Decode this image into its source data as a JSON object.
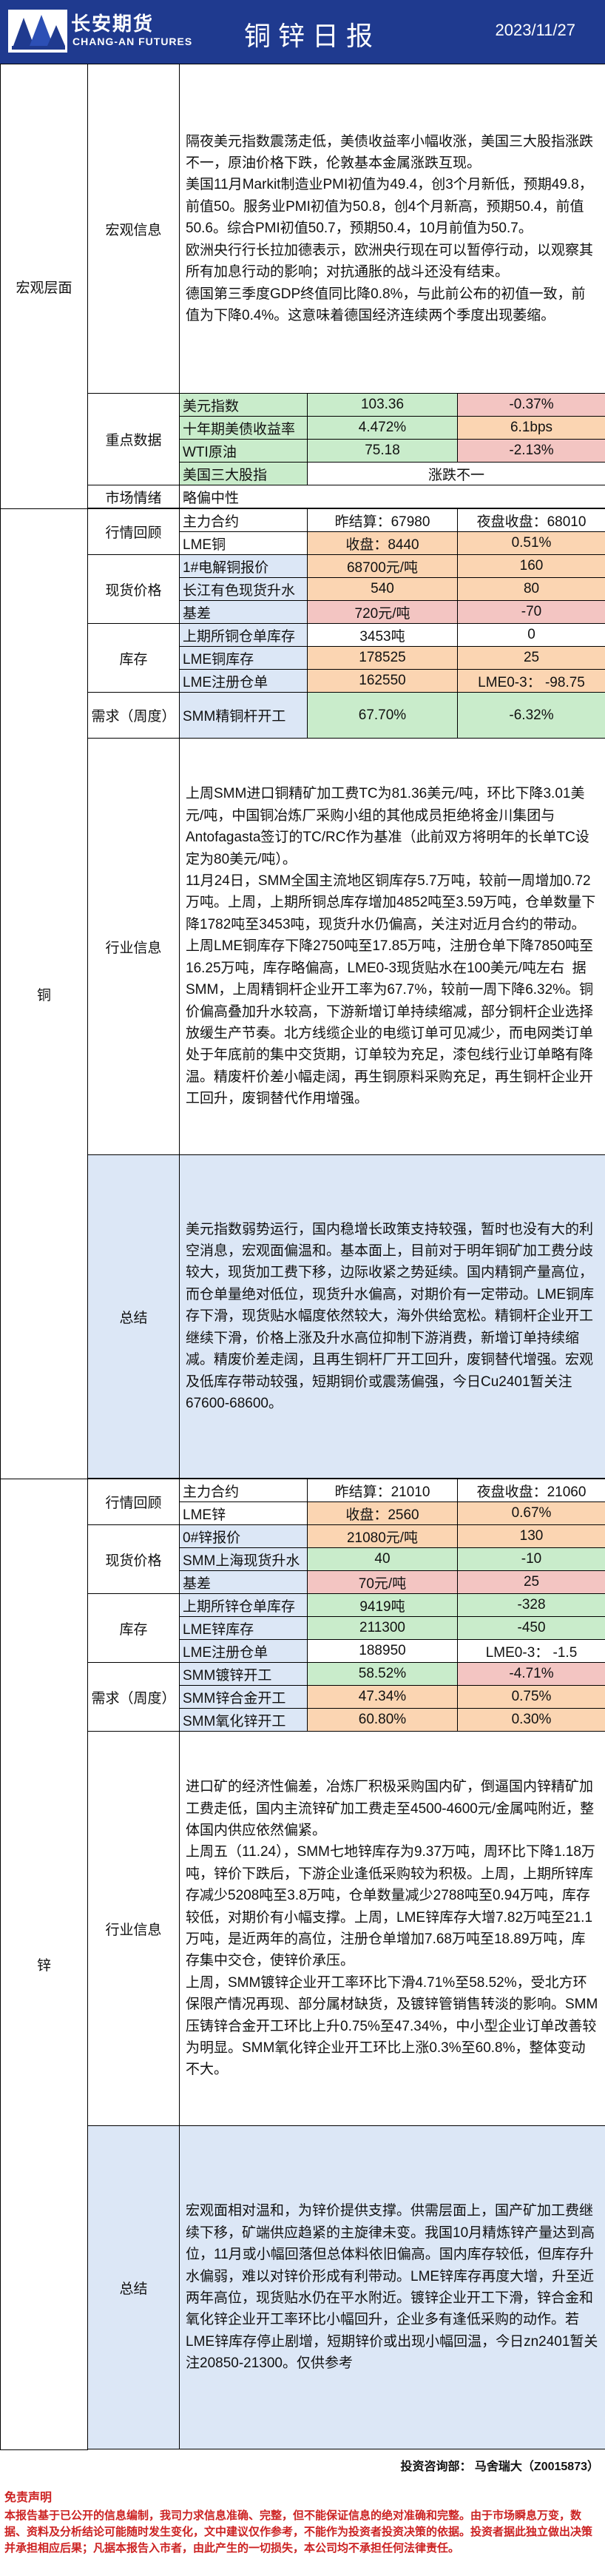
{
  "header": {
    "logo_cn": "长安期货",
    "logo_en": "CHANG-AN FUTURES",
    "title": "铜锌日报",
    "date": "2023/11/27"
  },
  "macro": {
    "section": "宏观层面",
    "info_label": "宏观信息",
    "info_text": "隔夜美元指数震荡走低，美债收益率小幅收涨，美国三大股指涨跌不一，原油价格下跌，伦敦基本金属涨跌互现。\n美国11月Markit制造业PMI初值为49.4，创3个月新低，预期49.8，前值50。服务业PMI初值为50.8，创4个月新高，预期50.4，前值50.6。综合PMI初值50.7，预期50.4，10月前值为50.7。\n欧洲央行行长拉加德表示，欧洲央行现在可以暂停行动，以观察其所有加息行动的影响；对抗通胀的战斗还没有结束。\n德国第三季度GDP终值同比降0.8%，与此前公布的初值一致，前值为下降0.4%。这意味着德国经济连续两个季度出现萎缩。",
    "key_label": "重点数据",
    "key_rows": [
      {
        "name": "美元指数",
        "value": "103.36",
        "change": "-0.37%"
      },
      {
        "name": "十年期美债收益率",
        "value": "4.472%",
        "change": "6.1bps"
      },
      {
        "name": "WTI原油",
        "value": "75.18",
        "change": "-2.13%"
      },
      {
        "name": "美国三大股指",
        "value": "",
        "change": "涨跌不一"
      }
    ],
    "sentiment_label": "市场情绪",
    "sentiment_value": "略偏中性"
  },
  "copper": {
    "section": "铜",
    "review_label": "行情回顾",
    "review_rows": [
      {
        "name": "主力合约",
        "a": "昨结算：67980",
        "b": "夜盘收盘：68010"
      },
      {
        "name": "LME铜",
        "a": "收盘：8440",
        "b": "0.51%"
      }
    ],
    "spot_label": "现货价格",
    "spot_rows": [
      {
        "name": "1#电解铜报价",
        "a": "68700元/吨",
        "b": "160"
      },
      {
        "name": "长江有色现货升水",
        "a": "540",
        "b": "80"
      },
      {
        "name": "基差",
        "a": "720元/吨",
        "b": "-70"
      }
    ],
    "stock_label": "库存",
    "stock_rows": [
      {
        "name": "上期所铜仓单库存",
        "a": "3453吨",
        "b": "0"
      },
      {
        "name": "LME铜库存",
        "a": "178525",
        "b": "25"
      },
      {
        "name": "LME注册仓单",
        "a": "162550",
        "b": "LME0-3：  -98.75"
      }
    ],
    "demand_label": "需求（周度）",
    "demand_rows": [
      {
        "name": "SMM精铜杆开工",
        "a": "67.70%",
        "b": "-6.32%"
      }
    ],
    "industry_label": "行业信息",
    "industry_text": "上周SMM进口铜精矿加工费TC为81.36美元/吨，环比下降3.01美元/吨，中国铜冶炼厂采购小组的其他成员拒绝将金川集团与Antofagasta签订的TC/RC作为基准（此前双方将明年的长单TC设定为80美元/吨）。\n11月24日，SMM全国主流地区铜库存5.7万吨，较前一周增加0.72万吨。上周，上期所铜总库存增加4852吨至3.59万吨，仓单数量下降1782吨至3453吨，现货升水仍偏高，关注对近月合约的带动。上周LME铜库存下降2750吨至17.85万吨，注册仓单下降7850吨至16.25万吨，库存略偏高，LME0-3现货贴水在100美元/吨左右  据SMM，上周精铜杆企业开工率为67.7%，较前一周下降6.32%。铜价偏高叠加升水较高，下游新增订单持续缩减，部分铜杆企业选择放缓生产节奏。北方线缆企业的电缆订单可见减少，而电网类订单处于年底前的集中交货期，订单较为充足，漆包线行业订单略有降温。精废杆价差小幅走阔，再生铜原料采购充足，再生铜杆企业开工回升，废铜替代作用增强。",
    "summary_label": "总结",
    "summary_text": "美元指数弱势运行，国内稳增长政策支持较强，暂时也没有大的利空消息，宏观面偏温和。基本面上，目前对于明年铜矿加工费分歧较大，现货加工费下移，边际收紧之势延续。国内精铜产量高位，而仓单量绝对低位，现货升水偏高，对期价有一定带动。LME铜库存下滑，现货贴水幅度依然较大，海外供给宽松。精铜杆企业开工继续下滑，价格上涨及升水高位抑制下游消费，新增订单持续缩减。精废价差走阔，且再生铜杆厂开工回升，废铜替代增强。宏观及低库存带动较强，短期铜价或震荡偏强，今日Cu2401暂关注67600-68600。"
  },
  "zinc": {
    "section": "锌",
    "review_label": "行情回顾",
    "review_rows": [
      {
        "name": "主力合约",
        "a": "昨结算：21010",
        "b": "夜盘收盘：21060"
      },
      {
        "name": "LME锌",
        "a": "收盘：2560",
        "b": "0.67%"
      }
    ],
    "spot_label": "现货价格",
    "spot_rows": [
      {
        "name": "0#锌报价",
        "a": "21080元/吨",
        "b": "130"
      },
      {
        "name": "SMM上海现货升水",
        "a": "40",
        "b": "-10"
      },
      {
        "name": "基差",
        "a": "70元/吨",
        "b": "25"
      }
    ],
    "stock_label": "库存",
    "stock_rows": [
      {
        "name": "上期所锌仓单库存",
        "a": "9419吨",
        "b": "-328"
      },
      {
        "name": "LME锌库存",
        "a": "211300",
        "b": "-450"
      },
      {
        "name": "LME注册仓单",
        "a": "188950",
        "b": "LME0-3：  -1.5"
      }
    ],
    "demand_label": "需求（周度）",
    "demand_rows": [
      {
        "name": "SMM镀锌开工",
        "a": "58.52%",
        "b": "-4.71%"
      },
      {
        "name": "SMM锌合金开工",
        "a": "47.34%",
        "b": "0.75%"
      },
      {
        "name": "SMM氧化锌开工",
        "a": "60.80%",
        "b": "0.30%"
      }
    ],
    "industry_label": "行业信息",
    "industry_text": "进口矿的经济性偏差，冶炼厂积极采购国内矿，倒逼国内锌精矿加工费走低，国内主流锌矿加工费走至4500-4600元/金属吨附近，整体国内供应依然偏紧。\n上周五（11.24），SMM七地锌库存为9.37万吨，周环比下降1.18万吨，锌价下跌后，下游企业逢低采购较为积极。上周，上期所锌库存减少5208吨至3.8万吨，仓单数量减少2788吨至0.94万吨，库存较低，对期价有小幅支撑。上周，LME锌库存大增7.82万吨至21.1万吨，是近两年的高位，注册仓单增加7.68万吨至18.89万吨，库存集中交仓，使锌价承压。\n上周，SMM镀锌企业开工率环比下滑4.71%至58.52%，受北方环保限产情况再现、部分属材缺货，及镀锌管销售转淡的影响。SMM压铸锌合金开工环比上升0.75%至47.34%，中小型企业订单改善较为明显。SMM氧化锌企业开工环比上涨0.3%至60.8%，整体变动不大。",
    "summary_label": "总结",
    "summary_text": "宏观面相对温和，为锌价提供支撑。供需层面上，国产矿加工费继续下移，矿端供应趋紧的主旋律未变。我国10月精炼锌产量达到高位，11月或小幅回落但总体料依旧偏高。国内库存较低，但库存升水偏弱，难以对锌价形成有利带动。LME锌库存再度大增，升至近两年高位，现货贴水仍在平水附近。镀锌企业开工下滑，锌合金和氧化锌企业开工率环比小幅回升，企业多有逢低采购的动作。若LME锌库存停止剧增，短期锌价或出现小幅回温，今日zn2401暂关注20850-21300。仅供参考"
  },
  "footer": {
    "analyst": "投资咨询部：  马舍瑞大（Z0015873）",
    "disclaimer_title": "免责声明",
    "disclaimer_text": "本报告基于已公开的信息编制，我司力求信息准确、完整，但不能保证信息的绝对准确和完整。由于市场瞬息万变，数据、资料及分析结论可能随时发生变化，文中建议仅作参考，不能作为投资者投资决策的依据。投资者据此独立做出决策并承担相应后果；凡据本报告入市者，由此产生的一切损失，本公司均不承担任何法律责任。"
  }
}
